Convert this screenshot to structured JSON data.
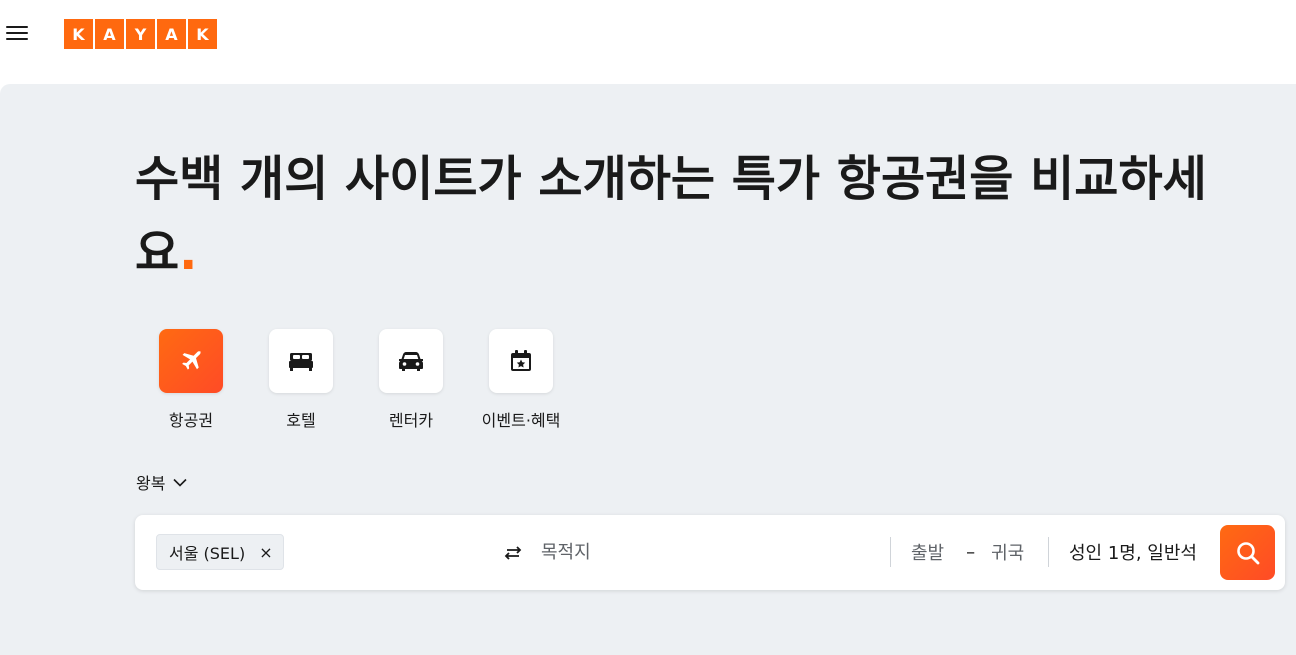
{
  "header": {
    "logo_letters": [
      "K",
      "A",
      "Y",
      "A",
      "K"
    ],
    "brand_color": "#ff690f",
    "menu_icon": "hamburger-icon"
  },
  "hero": {
    "headline": "수백 개의 사이트가 소개하는 특가 항공권을 비교하세요",
    "headline_dot": ".",
    "background": "#edf0f3"
  },
  "verticals": [
    {
      "label": "항공권",
      "icon": "plane-icon",
      "active": true
    },
    {
      "label": "호텔",
      "icon": "bed-icon",
      "active": false
    },
    {
      "label": "렌터카",
      "icon": "car-icon",
      "active": false
    },
    {
      "label": "이벤트·혜택",
      "icon": "calendar-star-icon",
      "active": false
    }
  ],
  "search": {
    "trip_type": "왕복",
    "origin": "서울 (SEL)",
    "origin_clear": "×",
    "destination_placeholder": "목적지",
    "depart_placeholder": "출발",
    "date_separator": "–",
    "return_placeholder": "귀국",
    "travelers": "성인 1명, 일반석",
    "search_icon": "search-icon"
  }
}
